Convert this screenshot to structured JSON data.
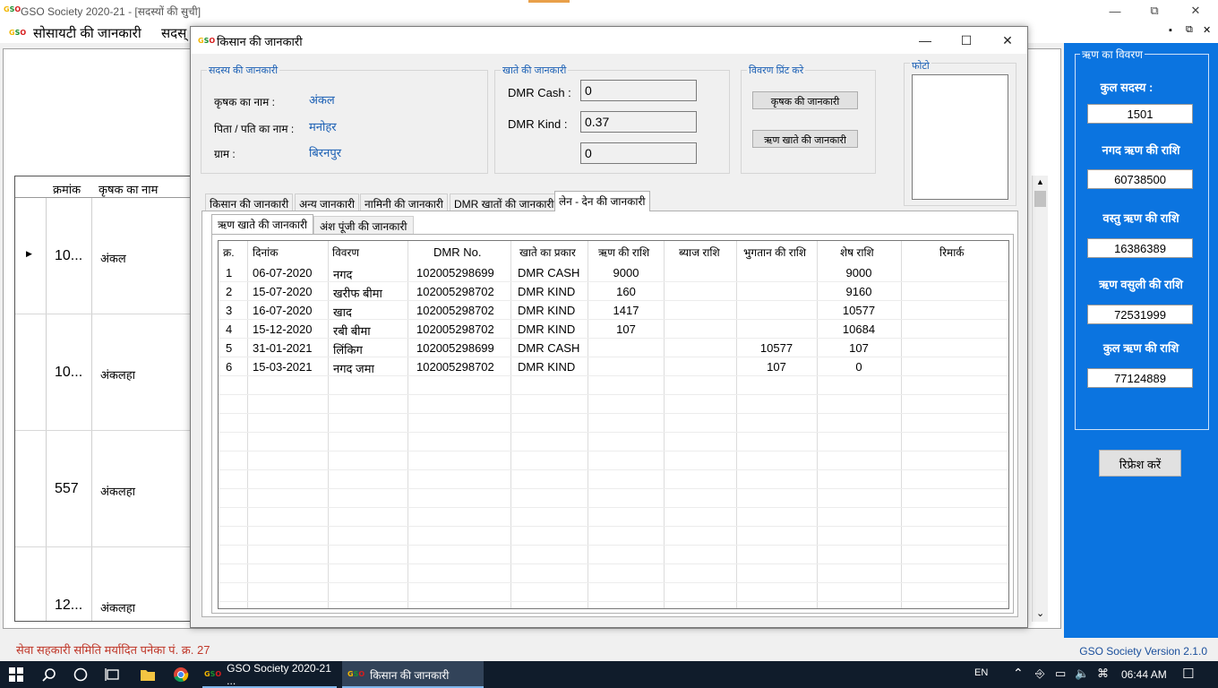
{
  "main_window": {
    "title": "GSO Society 2020-21 - [सदस्यों की सुची]",
    "menu": [
      "सोसायटी की जानकारी",
      "सदस्"
    ],
    "mdi_controls": [
      "▪",
      "⧉",
      "✕"
    ]
  },
  "member_grid": {
    "headers": [
      "क्रमांक",
      "कृषक का नाम"
    ],
    "rows": [
      {
        "num": "10...",
        "name": "अंकल",
        "current": true
      },
      {
        "num": "10...",
        "name": "अंकलहा",
        "current": false
      },
      {
        "num": "557",
        "name": "अंकलहा",
        "current": false
      },
      {
        "num": "12...",
        "name": "अंकलहा",
        "current": false
      }
    ]
  },
  "loan_panel": {
    "legend": "ऋण का विवरण",
    "items": [
      {
        "label": "कुल सदस्य :",
        "value": "1501"
      },
      {
        "label": "नगद ऋण की राशि",
        "value": "60738500"
      },
      {
        "label": "वस्तु ऋण की राशि",
        "value": "16386389"
      },
      {
        "label": "ऋण वसुली की राशि",
        "value": "72531999"
      },
      {
        "label": "कुल ऋण की राशि",
        "value": "77124889"
      }
    ],
    "refresh_label": "रिफ्रेश करें"
  },
  "status": {
    "left": "सेवा सहकारी समिति मर्यादित पनेका पं. क्र. 27",
    "right": "GSO Society Version 2.1.0"
  },
  "taskbar": {
    "apps": [
      {
        "label": "GSO Society 2020-21 ...",
        "active": false
      },
      {
        "label": "किसान की जानकारी",
        "active": true
      }
    ],
    "lang": "EN",
    "time": "06:44 AM"
  },
  "dialog": {
    "title": "किसान की जानकारी",
    "member_info": {
      "legend": "सदस्य की जानकारी",
      "name_label": "कृषक का नाम :",
      "name_value": "अंकल",
      "father_label": "पिता / पति का नाम :",
      "father_value": "मनोहर",
      "village_label": "ग्राम :",
      "village_value": "बिरनपुर"
    },
    "account_info": {
      "legend": "खाते  की जानकारी",
      "cash_label": "DMR Cash :",
      "cash_value": "0",
      "kind_label": "DMR Kind :",
      "kind_value": "0.37",
      "third_value": "0"
    },
    "print": {
      "legend": "विवरण प्रिंट करे",
      "btn_farmer": "कृषक की जानकारी",
      "btn_loan": "ऋण खाते की जानकारी"
    },
    "photo_legend": "फोटो",
    "tabs": [
      "किसान की जानकारी",
      "अन्य जानकारी",
      "नामिनी की जानकारी",
      "DMR खातों की जानकारी",
      "लेन - देन की जानकारी"
    ],
    "active_tab": 4,
    "subtabs": [
      "ऋण खाते की जानकारी",
      "अंश पूंजी की जानकारी"
    ],
    "active_subtab": 0,
    "ledger": {
      "headers": [
        "क्र.",
        "दिनांक",
        "विवरण",
        "DMR No.",
        "खाते का प्रकार",
        "ऋण की राशि",
        "ब्याज राशि",
        "भुगतान की राशि",
        "शेष राशि",
        "रिमार्क"
      ],
      "rows": [
        [
          "1",
          "06-07-2020",
          "नगद",
          "102005298699",
          "DMR CASH",
          "9000",
          "",
          "",
          "9000",
          ""
        ],
        [
          "2",
          "15-07-2020",
          "खरीफ बीमा",
          "102005298702",
          "DMR KIND",
          "160",
          "",
          "",
          "9160",
          ""
        ],
        [
          "3",
          "16-07-2020",
          "खाद",
          "102005298702",
          "DMR KIND",
          "1417",
          "",
          "",
          "10577",
          ""
        ],
        [
          "4",
          "15-12-2020",
          "रबी बीमा",
          "102005298702",
          "DMR KIND",
          "107",
          "",
          "",
          "10684",
          ""
        ],
        [
          "5",
          "31-01-2021",
          "लिंकिग",
          "102005298699",
          "DMR CASH",
          "",
          "",
          "10577",
          "107",
          ""
        ],
        [
          "6",
          "15-03-2021",
          "नगद जमा",
          "102005298702",
          "DMR KIND",
          "",
          "",
          "107",
          "0",
          ""
        ]
      ]
    }
  }
}
